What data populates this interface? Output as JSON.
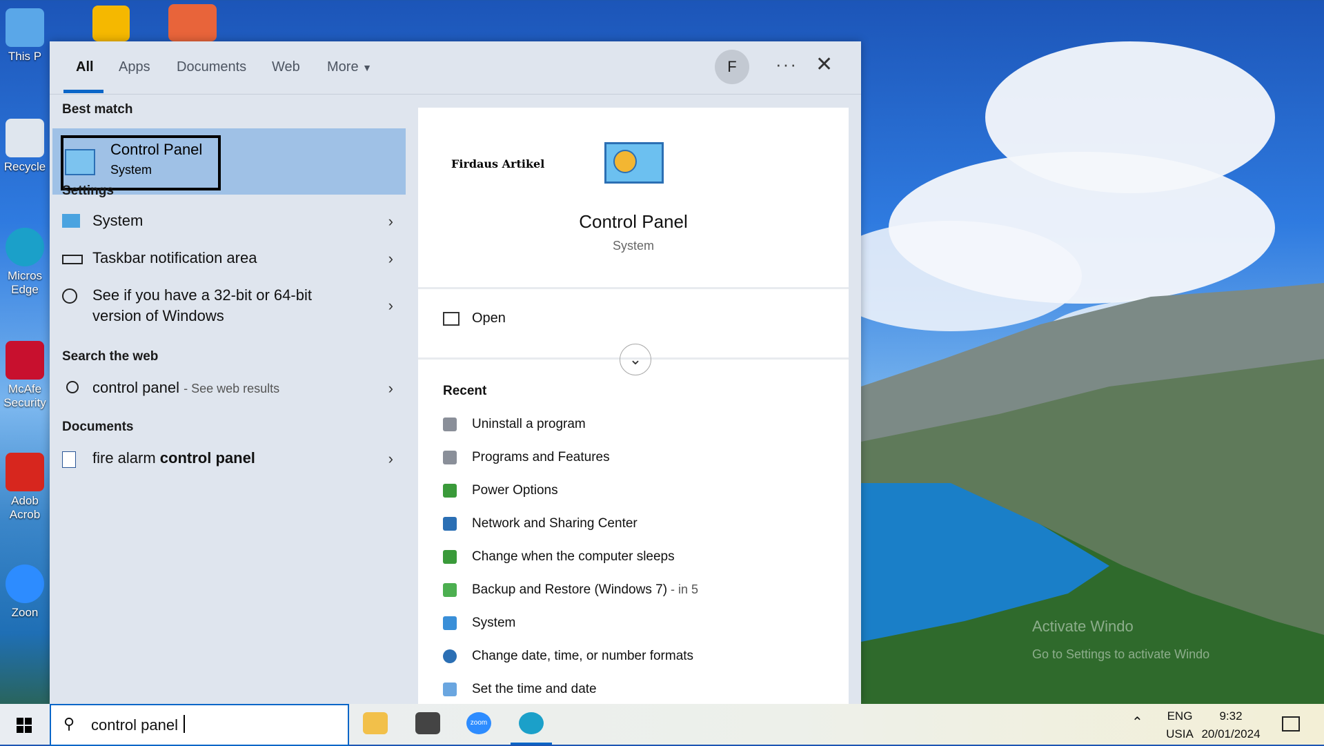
{
  "desktop": {
    "icons": [
      {
        "label": "This P"
      },
      {
        "label": "Recycle"
      },
      {
        "label": "Micros Edge"
      },
      {
        "label": "McAfe Security"
      },
      {
        "label": "Adob Acrob"
      },
      {
        "label": "Zoon"
      }
    ],
    "watermark_line1": "Activate Windo",
    "watermark_line2": "Go to Settings to activate Windo"
  },
  "panel": {
    "tabs": [
      "All",
      "Apps",
      "Documents",
      "Web",
      "More"
    ],
    "avatar_letter": "F",
    "more_options": "···",
    "close": "✕"
  },
  "left": {
    "best_match_heading": "Best match",
    "best_match": {
      "title": "Control Panel",
      "subtitle": "System"
    },
    "settings_heading": "Settings",
    "settings_items": [
      {
        "label": "System"
      },
      {
        "label": "Taskbar notification area"
      },
      {
        "label": "See if you have a 32-bit or 64-bit",
        "label2": "version of Windows"
      }
    ],
    "web_heading": "Search the web",
    "web_item": {
      "query": "control panel",
      "suffix": "- See web results"
    },
    "documents_heading": "Documents",
    "document_item": {
      "prefix": "fire alarm ",
      "bold": "control panel"
    }
  },
  "right": {
    "brand": "Firdaus Artikel",
    "title": "Control Panel",
    "subtitle": "System",
    "open_label": "Open",
    "recent_heading": "Recent",
    "recent_items": [
      {
        "label": "Uninstall a program",
        "suffix": "",
        "color": "#8a8f99"
      },
      {
        "label": "Programs and Features",
        "suffix": "",
        "color": "#8a8f99"
      },
      {
        "label": "Power Options",
        "suffix": "",
        "color": "#3a9a3a"
      },
      {
        "label": "Network and Sharing Center",
        "suffix": "",
        "color": "#2b6fb4"
      },
      {
        "label": "Change when the computer sleeps",
        "suffix": "",
        "color": "#3a9a3a"
      },
      {
        "label": "Backup and Restore (Windows 7)",
        "suffix": " - in 5",
        "color": "#4caf50"
      },
      {
        "label": "System",
        "suffix": "",
        "color": "#3a8fd8"
      },
      {
        "label": "Change date, time, or number formats",
        "suffix": "",
        "color": "#2b6fb4"
      },
      {
        "label": "Set the time and date",
        "suffix": "",
        "color": "#6aa6e0"
      }
    ]
  },
  "taskbar": {
    "search_query": "control panel",
    "lang": "ENG",
    "region": "USIA",
    "time": "9:32",
    "date": "20/01/2024",
    "zoom_label": "zoom"
  }
}
